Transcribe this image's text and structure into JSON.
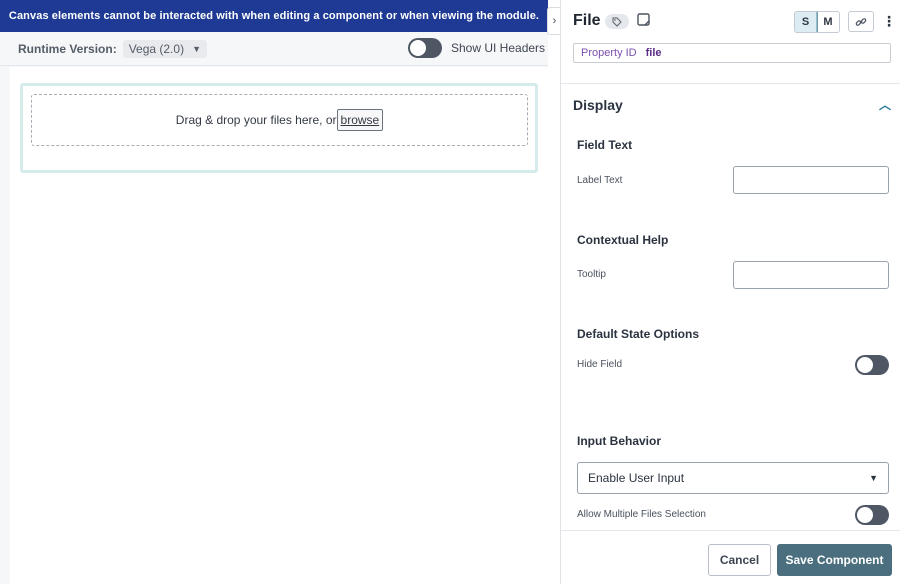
{
  "banner": {
    "text": "Canvas elements cannot be interacted with when editing a component or when viewing the module."
  },
  "runtime": {
    "label": "Runtime Version:",
    "value": "Vega (2.0)"
  },
  "ui_headers": {
    "label": "Show UI Headers",
    "on": false
  },
  "dropzone": {
    "text": "Drag & drop your files here, or",
    "browse_label": "browse"
  },
  "panel": {
    "title": "File",
    "size_options": [
      "S",
      "M"
    ],
    "size_selected": "S",
    "property_id": {
      "label": "Property ID",
      "value": "file"
    },
    "section": {
      "title": "Display"
    },
    "groups": {
      "field_text": {
        "title": "Field Text",
        "label_text": "Label Text",
        "label_text_value": ""
      },
      "contextual_help": {
        "title": "Contextual Help",
        "tooltip": "Tooltip",
        "tooltip_value": ""
      },
      "default_state": {
        "title": "Default State Options",
        "hide_field": "Hide Field",
        "hide_field_on": false
      },
      "input_behavior": {
        "title": "Input Behavior",
        "select_value": "Enable User Input",
        "allow_multiple": "Allow Multiple Files Selection",
        "allow_multiple_on": false
      }
    },
    "footer": {
      "cancel": "Cancel",
      "save": "Save Component"
    }
  },
  "icons": {
    "collapse": "chevron-right-icon",
    "tag": "tag-icon",
    "note": "note-icon",
    "link": "link-icon",
    "more": "more-vertical-icon",
    "section_toggle": "chevron-up-icon"
  },
  "colors": {
    "banner": "#1f3a94",
    "save_button": "#4b6f7f",
    "toggle_off": "#4e5763",
    "selected_size": "#dcecf2"
  }
}
